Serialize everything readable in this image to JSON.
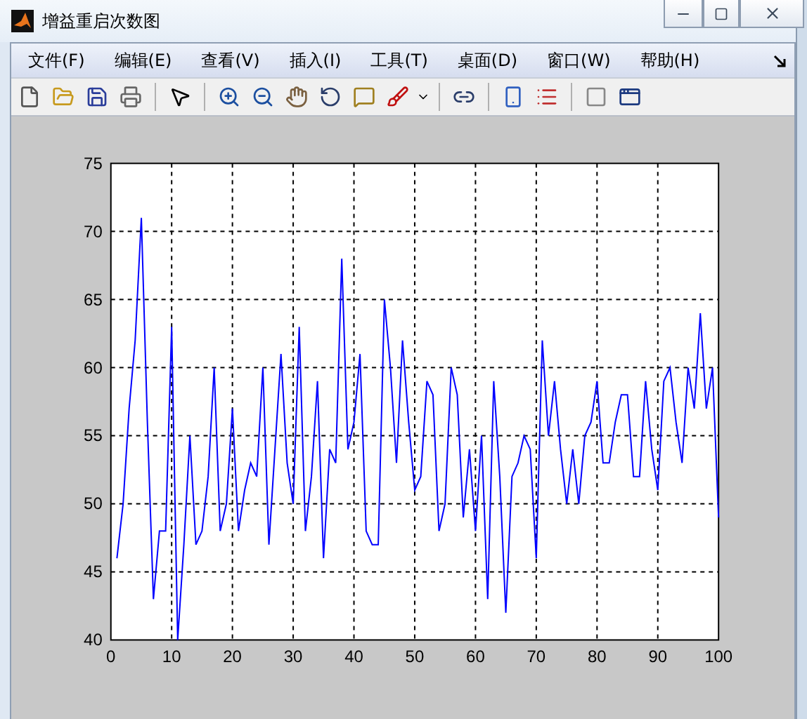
{
  "window": {
    "title": "增益重启次数图"
  },
  "menu": [
    {
      "label": "文件(F)"
    },
    {
      "label": "编辑(E)"
    },
    {
      "label": "查看(V)"
    },
    {
      "label": "插入(I)"
    },
    {
      "label": "工具(T)"
    },
    {
      "label": "桌面(D)"
    },
    {
      "label": "窗口(W)"
    },
    {
      "label": "帮助(H)"
    }
  ],
  "chart_data": {
    "type": "line",
    "grid": true,
    "xlim": [
      0,
      100
    ],
    "ylim": [
      40,
      75
    ],
    "xticks": [
      0,
      10,
      20,
      30,
      40,
      50,
      60,
      70,
      80,
      90,
      100
    ],
    "yticks": [
      40,
      45,
      50,
      55,
      60,
      65,
      70,
      75
    ],
    "x": [
      1,
      2,
      3,
      4,
      5,
      6,
      7,
      8,
      9,
      10,
      11,
      12,
      13,
      14,
      15,
      16,
      17,
      18,
      19,
      20,
      21,
      22,
      23,
      24,
      25,
      26,
      27,
      28,
      29,
      30,
      31,
      32,
      33,
      34,
      35,
      36,
      37,
      38,
      39,
      40,
      41,
      42,
      43,
      44,
      45,
      46,
      47,
      48,
      49,
      50,
      51,
      52,
      53,
      54,
      55,
      56,
      57,
      58,
      59,
      60,
      61,
      62,
      63,
      64,
      65,
      66,
      67,
      68,
      69,
      70,
      71,
      72,
      73,
      74,
      75,
      76,
      77,
      78,
      79,
      80,
      81,
      82,
      83,
      84,
      85,
      86,
      87,
      88,
      89,
      90,
      91,
      92,
      93,
      94,
      95,
      96,
      97,
      98,
      99,
      100
    ],
    "series": [
      {
        "color": "#0000ff",
        "values": [
          46,
          50,
          57,
          62,
          71,
          56,
          43,
          48,
          48,
          63,
          40,
          47,
          55,
          47,
          48,
          52,
          60,
          48,
          50,
          57,
          48,
          51,
          53,
          52,
          60,
          47,
          54,
          61,
          53,
          50,
          63,
          48,
          52,
          59,
          46,
          54,
          53,
          68,
          54,
          56,
          61,
          48,
          47,
          47,
          65,
          60,
          53,
          62,
          56,
          51,
          52,
          59,
          58,
          48,
          50,
          60,
          58,
          49,
          54,
          48,
          55,
          43,
          59,
          52,
          42,
          52,
          53,
          55,
          54,
          46,
          62,
          55,
          59,
          54,
          50,
          54,
          50,
          55,
          56,
          59,
          53,
          53,
          56,
          58,
          58,
          52,
          52,
          59,
          54,
          51,
          59,
          60,
          56,
          53,
          60,
          57,
          64,
          57,
          60,
          49
        ]
      }
    ]
  }
}
